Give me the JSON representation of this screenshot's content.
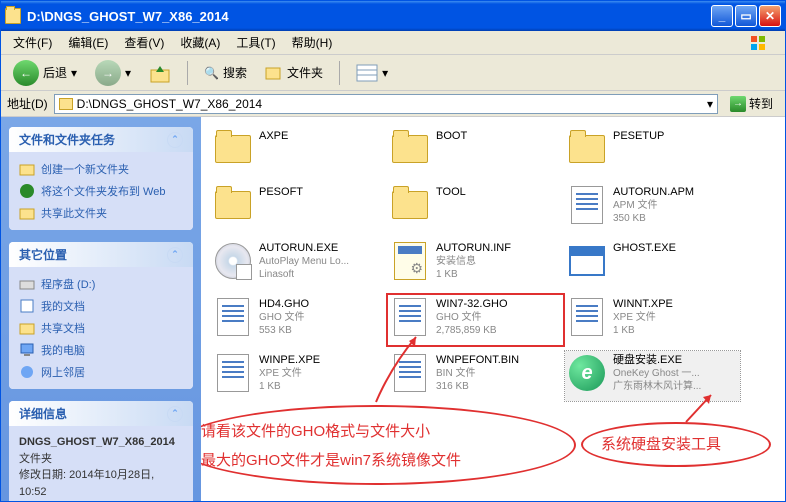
{
  "title": "D:\\DNGS_GHOST_W7_X86_2014",
  "menu": [
    "文件(F)",
    "编辑(E)",
    "查看(V)",
    "收藏(A)",
    "工具(T)",
    "帮助(H)"
  ],
  "toolbar": {
    "back": "后退",
    "search": "搜索",
    "folders": "文件夹"
  },
  "address": {
    "label": "地址(D)",
    "path": "D:\\DNGS_GHOST_W7_X86_2014",
    "go": "转到"
  },
  "sidebar": {
    "tasks": {
      "title": "文件和文件夹任务",
      "items": [
        "创建一个新文件夹",
        "将这个文件夹发布到 Web",
        "共享此文件夹"
      ]
    },
    "other": {
      "title": "其它位置",
      "items": [
        "程序盘 (D:)",
        "我的文档",
        "共享文档",
        "我的电脑",
        "网上邻居"
      ]
    },
    "details": {
      "title": "详细信息",
      "name": "DNGS_GHOST_W7_X86_2014",
      "type": "文件夹",
      "mod_label": "修改日期:",
      "mod": "2014年10月28日, 10:52"
    }
  },
  "files": [
    {
      "name": "AXPE",
      "icon": "folder"
    },
    {
      "name": "BOOT",
      "icon": "folder"
    },
    {
      "name": "PESETUP",
      "icon": "folder"
    },
    {
      "name": "PESOFT",
      "icon": "folder"
    },
    {
      "name": "TOOL",
      "icon": "folder"
    },
    {
      "name": "AUTORUN.APM",
      "l1": "APM 文件",
      "l2": "350 KB",
      "icon": "doc"
    },
    {
      "name": "AUTORUN.EXE",
      "l1": "AutoPlay Menu Lo...",
      "l2": "Linasoft",
      "icon": "cd"
    },
    {
      "name": "AUTORUN.INF",
      "l1": "安装信息",
      "l2": "1 KB",
      "icon": "inf"
    },
    {
      "name": "GHOST.EXE",
      "icon": "app"
    },
    {
      "name": "HD4.GHO",
      "l1": "GHO 文件",
      "l2": "553 KB",
      "icon": "doc"
    },
    {
      "name": "WIN7-32.GHO",
      "l1": "GHO 文件",
      "l2": "2,785,859 KB",
      "icon": "doc",
      "hl": true
    },
    {
      "name": "WINNT.XPE",
      "l1": "XPE 文件",
      "l2": "1 KB",
      "icon": "doc"
    },
    {
      "name": "WINPE.XPE",
      "l1": "XPE 文件",
      "l2": "1 KB",
      "icon": "doc"
    },
    {
      "name": "WNPEFONT.BIN",
      "l1": "BIN 文件",
      "l2": "316 KB",
      "icon": "doc"
    },
    {
      "name": "硬盘安装.EXE",
      "l1": "OneKey Ghost 一...",
      "l2": "广东雨林木风计算...",
      "icon": "green",
      "sel": true
    }
  ],
  "annotations": {
    "line1": "请看该文件的GHO格式与文件大小",
    "line2": "最大的GHO文件才是win7系统镜像文件",
    "right": "系统硬盘安装工具"
  }
}
